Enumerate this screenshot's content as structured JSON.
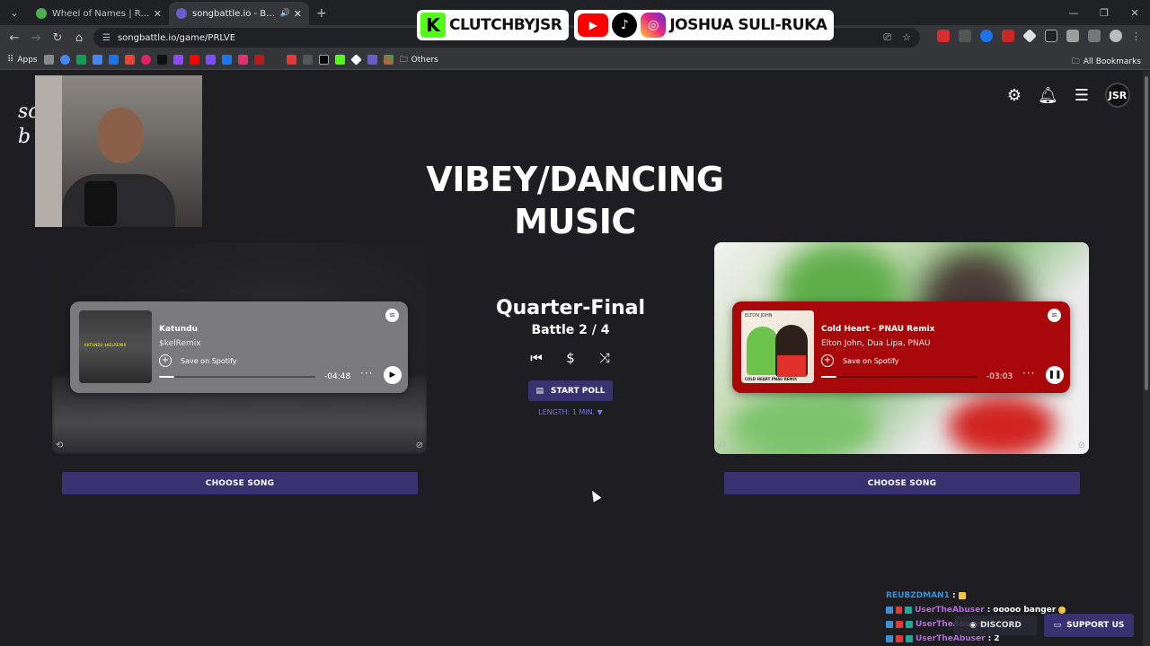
{
  "browser": {
    "tabs": [
      {
        "title": "Wheel of Names | Random nam",
        "favicon_color": "#4caf50",
        "active": false
      },
      {
        "title": "songbattle.io - Battle Songs",
        "favicon_color": "#3a3270",
        "active": true
      }
    ],
    "new_tab": "+",
    "url": "songbattle.io/game/PRLVE",
    "bookmarks_apps": "Apps",
    "bookmarks_others": "Others",
    "bookmarks_all": "All Bookmarks"
  },
  "overlay": {
    "kick_letter": "K",
    "kick_name": "CLUTCHBYJSR",
    "social_name": "JOSHUA SULI-RUKA"
  },
  "page": {
    "logo_partial_line1": "sc",
    "logo_partial_line2": "b",
    "avatar_text": "JSR",
    "category_title": "VIBEY/DANCING MUSIC",
    "round": "Quarter-Final",
    "battle": "Battle 2 / 4",
    "start_poll": "START POLL",
    "length": "LENGTH: 1 MIN. ▼",
    "choose_song_left": "CHOOSE SONG",
    "choose_song_right": "CHOOSE SONG",
    "left_song": {
      "title": "Katundu",
      "artist": "$kelRemix",
      "save": "Save on Spotify",
      "time": "-04:48",
      "progress": 0.1,
      "art_text": "KATUNDU $KELREMIX"
    },
    "right_song": {
      "title": "Cold Heart - PNAU Remix",
      "artist": "Elton John, Dua Lipa, PNAU",
      "save": "Save on Spotify",
      "time": "-03:03",
      "progress": 0.1,
      "art_top": "ELTON JOHN",
      "art_bottom": "COLD HEART PNAU REMIX"
    },
    "support": "SUPPORT US",
    "discord": "DISCORD"
  },
  "chat": [
    {
      "user": "REUBZDMAN1",
      "message": "",
      "user_color": "#3e8ed0"
    },
    {
      "user": "UserTheAbuser",
      "message": "ooooo banger",
      "user_color": "#b667e0"
    },
    {
      "user": "UserTheAbuser",
      "message": "",
      "user_color": "#b667e0"
    },
    {
      "user": "UserTheAbuser",
      "message": "2",
      "user_color": "#b667e0"
    }
  ],
  "colors": {
    "accent": "#3a3270",
    "right_card": "#a8080a",
    "left_card": "#7a7a7c",
    "page_bg": "#1e1d22"
  }
}
